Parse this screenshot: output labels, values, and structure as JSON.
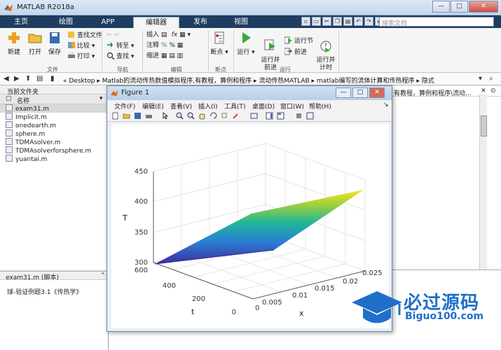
{
  "window": {
    "title": "MATLAB R2018a",
    "min": "—",
    "max": "□",
    "close": "✕"
  },
  "tabs": [
    "主页",
    "绘图",
    "APP",
    "编辑器",
    "发布",
    "视图"
  ],
  "search": {
    "placeholder": "搜索文档"
  },
  "ribbon": {
    "file": {
      "new": "新建",
      "open": "打开",
      "save": "保存",
      "find_files": "查找文件",
      "compare": "比较",
      "print": "打印",
      "group": "文件"
    },
    "nav": {
      "goto": "转至",
      "find": "查找",
      "group": "导航"
    },
    "edit": {
      "insert": "插入",
      "comment": "注释",
      "indent": "缩进",
      "group": "编辑"
    },
    "breakpoints": {
      "label": "断点",
      "group": "断点"
    },
    "run": {
      "run": "运行",
      "run_advance": "运行并\n前进",
      "run_section": "运行节",
      "advance": "前进",
      "run_time": "运行并\n计时",
      "group": "运行"
    }
  },
  "address": {
    "segments": [
      "« Desktop",
      "Matlab的流动传热数值模拟程序,有教程，算例和程序",
      "流动传热MATLAB",
      "matlab编写的流体计算和传热程序",
      "隐式"
    ],
    "right_text": "有教程，算例和程序\\流动..."
  },
  "current_folder": {
    "title": "当前文件夹",
    "column": "名称",
    "files": [
      "exam31.m",
      "Implicit.m",
      "onedearth.m",
      "sphere.m",
      "TDMAsolver.m",
      "TDMAsolverforsphere.m",
      "yuantai.m"
    ]
  },
  "details": {
    "title": "exam31.m  (脚本)",
    "text": "球-验证例题3.1《传热学》"
  },
  "figure": {
    "title": "Figure 1",
    "menu": [
      "文件(F)",
      "编辑(E)",
      "查看(V)",
      "插入(I)",
      "工具(T)",
      "桌面(D)",
      "窗口(W)",
      "帮助(H)"
    ],
    "plot": {
      "zlabel": "T",
      "xlabel": "x",
      "ylabel": "t",
      "zticks": [
        "300",
        "350",
        "400",
        "450"
      ],
      "xticks": [
        "0",
        "0.005",
        "0.01",
        "0.015",
        "0.02",
        "0.025"
      ],
      "yticks": [
        "0",
        "200",
        "400",
        "600"
      ]
    }
  },
  "watermark": {
    "brand": "必过源码",
    "url": "Biguo100.com"
  }
}
